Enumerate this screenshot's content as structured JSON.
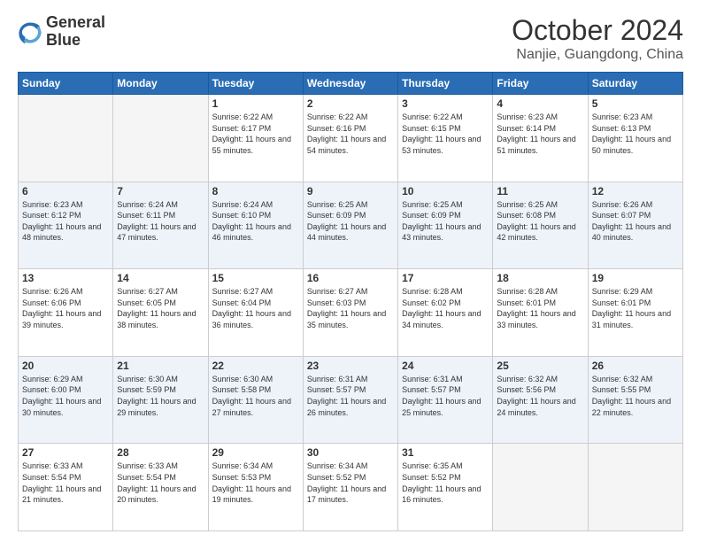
{
  "header": {
    "logo_line1": "General",
    "logo_line2": "Blue",
    "month_title": "October 2024",
    "location": "Nanjie, Guangdong, China"
  },
  "days_of_week": [
    "Sunday",
    "Monday",
    "Tuesday",
    "Wednesday",
    "Thursday",
    "Friday",
    "Saturday"
  ],
  "weeks": [
    [
      {
        "day": "",
        "sunrise": "",
        "sunset": "",
        "daylight": ""
      },
      {
        "day": "",
        "sunrise": "",
        "sunset": "",
        "daylight": ""
      },
      {
        "day": "1",
        "sunrise": "Sunrise: 6:22 AM",
        "sunset": "Sunset: 6:17 PM",
        "daylight": "Daylight: 11 hours and 55 minutes."
      },
      {
        "day": "2",
        "sunrise": "Sunrise: 6:22 AM",
        "sunset": "Sunset: 6:16 PM",
        "daylight": "Daylight: 11 hours and 54 minutes."
      },
      {
        "day": "3",
        "sunrise": "Sunrise: 6:22 AM",
        "sunset": "Sunset: 6:15 PM",
        "daylight": "Daylight: 11 hours and 53 minutes."
      },
      {
        "day": "4",
        "sunrise": "Sunrise: 6:23 AM",
        "sunset": "Sunset: 6:14 PM",
        "daylight": "Daylight: 11 hours and 51 minutes."
      },
      {
        "day": "5",
        "sunrise": "Sunrise: 6:23 AM",
        "sunset": "Sunset: 6:13 PM",
        "daylight": "Daylight: 11 hours and 50 minutes."
      }
    ],
    [
      {
        "day": "6",
        "sunrise": "Sunrise: 6:23 AM",
        "sunset": "Sunset: 6:12 PM",
        "daylight": "Daylight: 11 hours and 48 minutes."
      },
      {
        "day": "7",
        "sunrise": "Sunrise: 6:24 AM",
        "sunset": "Sunset: 6:11 PM",
        "daylight": "Daylight: 11 hours and 47 minutes."
      },
      {
        "day": "8",
        "sunrise": "Sunrise: 6:24 AM",
        "sunset": "Sunset: 6:10 PM",
        "daylight": "Daylight: 11 hours and 46 minutes."
      },
      {
        "day": "9",
        "sunrise": "Sunrise: 6:25 AM",
        "sunset": "Sunset: 6:09 PM",
        "daylight": "Daylight: 11 hours and 44 minutes."
      },
      {
        "day": "10",
        "sunrise": "Sunrise: 6:25 AM",
        "sunset": "Sunset: 6:09 PM",
        "daylight": "Daylight: 11 hours and 43 minutes."
      },
      {
        "day": "11",
        "sunrise": "Sunrise: 6:25 AM",
        "sunset": "Sunset: 6:08 PM",
        "daylight": "Daylight: 11 hours and 42 minutes."
      },
      {
        "day": "12",
        "sunrise": "Sunrise: 6:26 AM",
        "sunset": "Sunset: 6:07 PM",
        "daylight": "Daylight: 11 hours and 40 minutes."
      }
    ],
    [
      {
        "day": "13",
        "sunrise": "Sunrise: 6:26 AM",
        "sunset": "Sunset: 6:06 PM",
        "daylight": "Daylight: 11 hours and 39 minutes."
      },
      {
        "day": "14",
        "sunrise": "Sunrise: 6:27 AM",
        "sunset": "Sunset: 6:05 PM",
        "daylight": "Daylight: 11 hours and 38 minutes."
      },
      {
        "day": "15",
        "sunrise": "Sunrise: 6:27 AM",
        "sunset": "Sunset: 6:04 PM",
        "daylight": "Daylight: 11 hours and 36 minutes."
      },
      {
        "day": "16",
        "sunrise": "Sunrise: 6:27 AM",
        "sunset": "Sunset: 6:03 PM",
        "daylight": "Daylight: 11 hours and 35 minutes."
      },
      {
        "day": "17",
        "sunrise": "Sunrise: 6:28 AM",
        "sunset": "Sunset: 6:02 PM",
        "daylight": "Daylight: 11 hours and 34 minutes."
      },
      {
        "day": "18",
        "sunrise": "Sunrise: 6:28 AM",
        "sunset": "Sunset: 6:01 PM",
        "daylight": "Daylight: 11 hours and 33 minutes."
      },
      {
        "day": "19",
        "sunrise": "Sunrise: 6:29 AM",
        "sunset": "Sunset: 6:01 PM",
        "daylight": "Daylight: 11 hours and 31 minutes."
      }
    ],
    [
      {
        "day": "20",
        "sunrise": "Sunrise: 6:29 AM",
        "sunset": "Sunset: 6:00 PM",
        "daylight": "Daylight: 11 hours and 30 minutes."
      },
      {
        "day": "21",
        "sunrise": "Sunrise: 6:30 AM",
        "sunset": "Sunset: 5:59 PM",
        "daylight": "Daylight: 11 hours and 29 minutes."
      },
      {
        "day": "22",
        "sunrise": "Sunrise: 6:30 AM",
        "sunset": "Sunset: 5:58 PM",
        "daylight": "Daylight: 11 hours and 27 minutes."
      },
      {
        "day": "23",
        "sunrise": "Sunrise: 6:31 AM",
        "sunset": "Sunset: 5:57 PM",
        "daylight": "Daylight: 11 hours and 26 minutes."
      },
      {
        "day": "24",
        "sunrise": "Sunrise: 6:31 AM",
        "sunset": "Sunset: 5:57 PM",
        "daylight": "Daylight: 11 hours and 25 minutes."
      },
      {
        "day": "25",
        "sunrise": "Sunrise: 6:32 AM",
        "sunset": "Sunset: 5:56 PM",
        "daylight": "Daylight: 11 hours and 24 minutes."
      },
      {
        "day": "26",
        "sunrise": "Sunrise: 6:32 AM",
        "sunset": "Sunset: 5:55 PM",
        "daylight": "Daylight: 11 hours and 22 minutes."
      }
    ],
    [
      {
        "day": "27",
        "sunrise": "Sunrise: 6:33 AM",
        "sunset": "Sunset: 5:54 PM",
        "daylight": "Daylight: 11 hours and 21 minutes."
      },
      {
        "day": "28",
        "sunrise": "Sunrise: 6:33 AM",
        "sunset": "Sunset: 5:54 PM",
        "daylight": "Daylight: 11 hours and 20 minutes."
      },
      {
        "day": "29",
        "sunrise": "Sunrise: 6:34 AM",
        "sunset": "Sunset: 5:53 PM",
        "daylight": "Daylight: 11 hours and 19 minutes."
      },
      {
        "day": "30",
        "sunrise": "Sunrise: 6:34 AM",
        "sunset": "Sunset: 5:52 PM",
        "daylight": "Daylight: 11 hours and 17 minutes."
      },
      {
        "day": "31",
        "sunrise": "Sunrise: 6:35 AM",
        "sunset": "Sunset: 5:52 PM",
        "daylight": "Daylight: 11 hours and 16 minutes."
      },
      {
        "day": "",
        "sunrise": "",
        "sunset": "",
        "daylight": ""
      },
      {
        "day": "",
        "sunrise": "",
        "sunset": "",
        "daylight": ""
      }
    ]
  ]
}
